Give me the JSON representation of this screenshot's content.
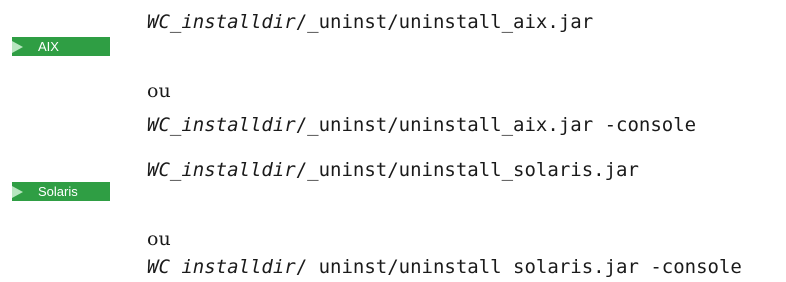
{
  "badges": {
    "aix": "AIX",
    "solaris": "Solaris"
  },
  "or_word": "ou",
  "commands": {
    "aix_1": {
      "var": "WC_installdir",
      "rest": "/_uninst/uninstall_aix.jar"
    },
    "aix_2": {
      "var": "WC_installdir",
      "rest": "/_uninst/uninstall_aix.jar -console"
    },
    "solaris_1": {
      "var": "WC_installdir",
      "rest": "/_uninst/uninstall_solaris.jar"
    },
    "solaris_2": {
      "var": "WC installdir",
      "rest": "/ uninst/uninstall solaris.jar -console"
    }
  },
  "colors": {
    "badge_bg": "#2f9e44",
    "badge_arrow": "#b8e6c0"
  }
}
